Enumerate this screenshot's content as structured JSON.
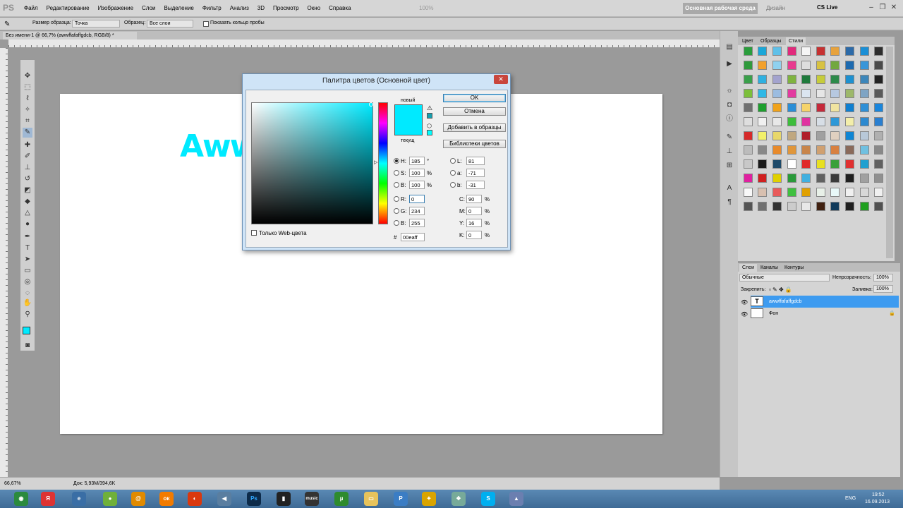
{
  "app": {
    "logo": "PS",
    "menu": [
      "Файл",
      "Редактирование",
      "Изображение",
      "Слои",
      "Выделение",
      "Фильтр",
      "Анализ",
      "3D",
      "Просмотр",
      "Окно",
      "Справка"
    ],
    "zoom_display": "100%",
    "workspace_button": "Основная рабочая среда",
    "design_label": "Дизайн",
    "cslive_label": "CS Live",
    "win_minimize": "–",
    "win_restore": "❐",
    "win_close": "✕"
  },
  "options_bar": {
    "sample_size_label": "Размер образца:",
    "sample_size_value": "Точка",
    "sample_label": "Образец:",
    "sample_value": "Все слои",
    "show_ring_label": "Показать кольцо пробы"
  },
  "document": {
    "tab_title": "Без имени-1 @ 66,7% (awwffafaffgdcb, RGB/8) *",
    "canvas_text": "Aww",
    "zoom": "66,67%",
    "doc_info": "Док: 5,93M/394,6K"
  },
  "styles_panel": {
    "tabs": [
      "Цвет",
      "Образцы",
      "Стили"
    ],
    "active_tab": "Стили"
  },
  "layers_panel": {
    "tabs": [
      "Слои",
      "Каналы",
      "Контуры"
    ],
    "blend_mode": "Обычные",
    "opacity_label": "Непрозрачность:",
    "opacity_value": "100%",
    "lock_label": "Закрепить:",
    "fill_label": "Заливка:",
    "fill_value": "100%",
    "layers": [
      {
        "name": "awwffafaffgdcb",
        "thumb": "T",
        "selected": true
      },
      {
        "name": "Фон",
        "thumb": "",
        "selected": false
      }
    ]
  },
  "color_picker": {
    "title": "Палитра цветов (Основной цвет)",
    "close": "✕",
    "new_label": "новый",
    "current_label": "текущ",
    "new_color": "#00eaff",
    "current_color": "#00eaff",
    "ok": "OK",
    "cancel": "Отмена",
    "add_to_swatches": "Добавить в образцы",
    "color_libraries": "Библиотеки цветов",
    "web_only_label": "Только Web-цвета",
    "fields": {
      "H": {
        "label": "H:",
        "value": "185",
        "unit": "°"
      },
      "S": {
        "label": "S:",
        "value": "100",
        "unit": "%"
      },
      "Bv": {
        "label": "B:",
        "value": "100",
        "unit": "%"
      },
      "R": {
        "label": "R:",
        "value": "0"
      },
      "G": {
        "label": "G:",
        "value": "234"
      },
      "Bc": {
        "label": "B:",
        "value": "255"
      },
      "L": {
        "label": "L:",
        "value": "81"
      },
      "a": {
        "label": "a:",
        "value": "-71"
      },
      "bl": {
        "label": "b:",
        "value": "-31"
      },
      "C": {
        "label": "C:",
        "value": "90",
        "unit": "%"
      },
      "M": {
        "label": "M:",
        "value": "0",
        "unit": "%"
      },
      "Y": {
        "label": "Y:",
        "value": "16",
        "unit": "%"
      },
      "K": {
        "label": "K:",
        "value": "0",
        "unit": "%"
      },
      "hex_label": "#",
      "hex": "00eaff"
    }
  },
  "colors": {
    "foreground": "#00eaff",
    "background": "#ffffff",
    "layer_selected": "#3d9bf0"
  },
  "taskbar": {
    "lang": "ENG",
    "time": "19:52",
    "date": "16.09.2013",
    "ps_label": "Ps",
    "music_label": "music"
  }
}
